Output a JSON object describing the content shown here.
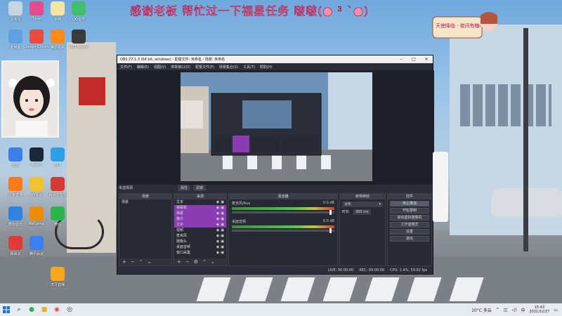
{
  "banner": "感谢老板 帮忙过一下福星任务 啵啵(● ³ `●)",
  "anime_sign": "天使降临 · 夜间有糖cc",
  "desktop_icons": [
    {
      "label": "回收站",
      "color": "#c8d4e0"
    },
    {
      "label": "iTunes",
      "color": "#e24d8c"
    },
    {
      "label": "示例",
      "color": "#f3e6a4"
    },
    {
      "label": "QQ音乐",
      "color": "#41c06b"
    },
    {
      "label": "此电脑",
      "color": "#5ea0e0"
    },
    {
      "label": "Google Chrome",
      "color": "#e94b3c"
    },
    {
      "label": "腾讯视频",
      "color": "#ff8a1c"
    },
    {
      "label": "OBS Studio",
      "color": "#3a3a3a"
    },
    {
      "label": "迅雷",
      "color": "#3b7de9"
    },
    {
      "label": "Steam",
      "color": "#1b2838"
    },
    {
      "label": "QQ",
      "color": "#2d9fe6"
    },
    {
      "label": "斗鱼直播",
      "color": "#ff7a1a"
    },
    {
      "label": "YY语音",
      "color": "#f2c12e"
    },
    {
      "label": "网易云音乐",
      "color": "#d33a31"
    },
    {
      "label": "酷狗音乐",
      "color": "#2f82e0"
    },
    {
      "label": "WeGame",
      "color": "#f08c00"
    },
    {
      "label": "微信",
      "color": "#2bb44d"
    },
    {
      "label": "网易云",
      "color": "#e23a3a"
    },
    {
      "label": "腾讯会议",
      "color": "#3d7ff3"
    },
    {
      "label": "虎牙直播",
      "color": "#f7a71b"
    }
  ],
  "obs": {
    "title": "OBS 27.1.3 (64 bit, windows) - 配置文件: 未命名 - 场景: 未命名",
    "menu": [
      "文件(F)",
      "编辑(E)",
      "视图(V)",
      "停靠窗口(D)",
      "配置文件(P)",
      "场景集合(S)",
      "工具(T)",
      "帮助(H)"
    ],
    "scene_line": "未选择源",
    "scene_controls": [
      "属性",
      "滤镜"
    ],
    "panels": {
      "scenes": {
        "title": "场景",
        "items": [
          "场景"
        ]
      },
      "sources": {
        "title": "来源",
        "items": [
          "文本",
          "弹幕机",
          "弹幕",
          "猫爪",
          "文本",
          "视频",
          "麦克风",
          "摄像头",
          "桌面音频",
          "窗口采集"
        ]
      },
      "mixer": {
        "title": "混音器",
        "channels": [
          {
            "name": "麦克风/Aux",
            "db": "0.0 dB"
          },
          {
            "name": "桌面音频",
            "db": "0.0 dB"
          }
        ]
      },
      "transitions": {
        "title": "转场特效",
        "type": "淡化",
        "duration_label": "时长",
        "duration": "300 ms"
      },
      "controls": {
        "title": "控件",
        "buttons": [
          "停止推流",
          "开始录制",
          "启动虚拟摄像机",
          "工作室模式",
          "设置",
          "退出"
        ]
      }
    },
    "status": {
      "live": "LIVE: 00:00:00",
      "rec": "REC: 00:00:00",
      "cpu": "CPU: 1.4%, 59.92 fps"
    }
  },
  "taskbar": {
    "weather": "10°C 多云",
    "time": "15:43",
    "date": "2021/12/27",
    "lang": "中"
  }
}
